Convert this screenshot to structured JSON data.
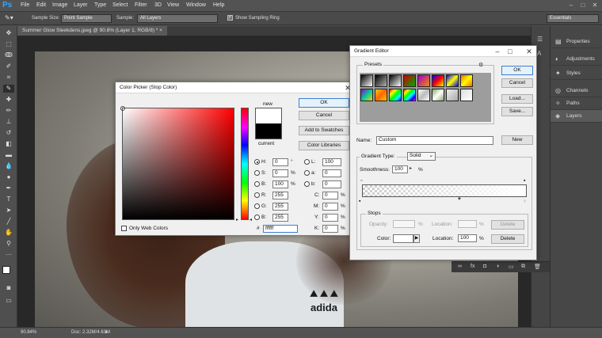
{
  "app": {
    "logo": "Ps"
  },
  "menu": [
    "File",
    "Edit",
    "Image",
    "Layer",
    "Type",
    "Select",
    "Filter",
    "3D",
    "View",
    "Window",
    "Help"
  ],
  "options_bar": {
    "sample_size_label": "Sample Size:",
    "sample_size_value": "Point Sample",
    "sample_label": "Sample:",
    "sample_value": "All Layers",
    "show_ring_label": "Show Sampling Ring",
    "workspace": "Essentials"
  },
  "document": {
    "tab_title": "Summer Glow Sleekdens.jpeg @ 90.8% (Layer 1, RGB/8) *",
    "shirt_logo_text": "adida"
  },
  "status": {
    "zoom": "90.84%",
    "doc": "Doc: 2.32M/4.63M"
  },
  "panels": [
    "Properties",
    "Adjustments",
    "Styles",
    "Channels",
    "Paths",
    "Layers"
  ],
  "color_picker": {
    "title": "Color Picker (Stop Color)",
    "ok": "OK",
    "cancel": "Cancel",
    "add_swatches": "Add to Swatches",
    "color_libraries": "Color Libraries",
    "new_label": "new",
    "current_label": "current",
    "only_web_colors": "Only Web Colors",
    "hsb": {
      "h_label": "H:",
      "h": "0",
      "h_unit": "°",
      "s_label": "S:",
      "s": "0",
      "s_unit": "%",
      "b_label": "B:",
      "b": "100",
      "b_unit": "%"
    },
    "rgb": {
      "r_label": "R:",
      "r": "255",
      "g_label": "G:",
      "g": "255",
      "b_label": "B:",
      "b": "255"
    },
    "lab": {
      "l_label": "L:",
      "l": "100",
      "a_label": "a:",
      "a": "0",
      "b_label": "b:",
      "b": "0"
    },
    "cmyk": {
      "c_label": "C:",
      "c": "0",
      "m_label": "M:",
      "m": "0",
      "y_label": "Y:",
      "y": "0",
      "k_label": "K:",
      "k": "0",
      "unit": "%"
    },
    "hex_label": "#",
    "hex": "ffffff"
  },
  "gradient_editor": {
    "title": "Gradient Editor",
    "presets_label": "Presets",
    "ok": "OK",
    "cancel": "Cancel",
    "load": "Load...",
    "save": "Save...",
    "name_label": "Name:",
    "name_value": "Custom",
    "new_button": "New",
    "gradient_type_label": "Gradient Type:",
    "gradient_type_value": "Solid",
    "smoothness_label": "Smoothness:",
    "smoothness_value": "100",
    "smoothness_unit": "%",
    "stops_label": "Stops",
    "opacity_label": "Opacity:",
    "opacity_unit": "%",
    "location_label": "Location:",
    "location_unit": "%",
    "delete_label": "Delete",
    "color_label": "Color:",
    "color_location_value": "100",
    "color_location_unit": "%",
    "color_delete_label": "Delete"
  }
}
